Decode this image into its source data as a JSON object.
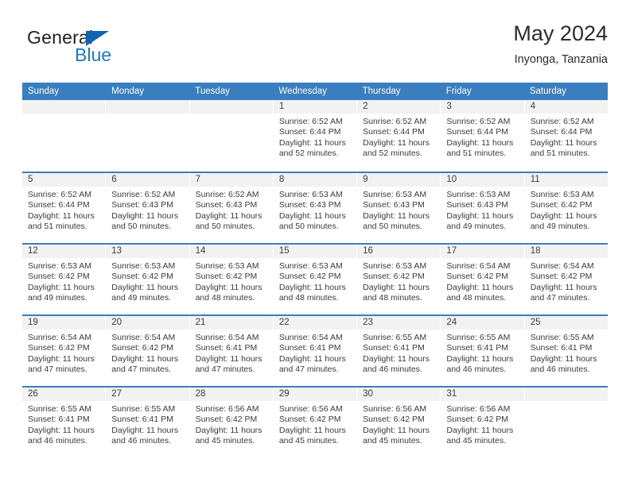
{
  "logo": {
    "word_top": "General",
    "word_bottom": "Blue",
    "triangle_color": "#1263ad",
    "blue_color": "#1f78c1"
  },
  "header": {
    "title": "May 2024",
    "subtitle": "Inyonga, Tanzania"
  },
  "theme": {
    "header_blue": "#3a7ebf",
    "day_strip_gray": "#f2f2f2",
    "text": "#3b3b3b"
  },
  "weekdays": [
    "Sunday",
    "Monday",
    "Tuesday",
    "Wednesday",
    "Thursday",
    "Friday",
    "Saturday"
  ],
  "weeks": [
    [
      {
        "day": "",
        "empty": true
      },
      {
        "day": "",
        "empty": true
      },
      {
        "day": "",
        "empty": true
      },
      {
        "day": "1",
        "sunrise": "Sunrise: 6:52 AM",
        "sunset": "Sunset: 6:44 PM",
        "daylight1": "Daylight: 11 hours",
        "daylight2": "and 52 minutes."
      },
      {
        "day": "2",
        "sunrise": "Sunrise: 6:52 AM",
        "sunset": "Sunset: 6:44 PM",
        "daylight1": "Daylight: 11 hours",
        "daylight2": "and 52 minutes."
      },
      {
        "day": "3",
        "sunrise": "Sunrise: 6:52 AM",
        "sunset": "Sunset: 6:44 PM",
        "daylight1": "Daylight: 11 hours",
        "daylight2": "and 51 minutes."
      },
      {
        "day": "4",
        "sunrise": "Sunrise: 6:52 AM",
        "sunset": "Sunset: 6:44 PM",
        "daylight1": "Daylight: 11 hours",
        "daylight2": "and 51 minutes."
      }
    ],
    [
      {
        "day": "5",
        "sunrise": "Sunrise: 6:52 AM",
        "sunset": "Sunset: 6:44 PM",
        "daylight1": "Daylight: 11 hours",
        "daylight2": "and 51 minutes."
      },
      {
        "day": "6",
        "sunrise": "Sunrise: 6:52 AM",
        "sunset": "Sunset: 6:43 PM",
        "daylight1": "Daylight: 11 hours",
        "daylight2": "and 50 minutes."
      },
      {
        "day": "7",
        "sunrise": "Sunrise: 6:52 AM",
        "sunset": "Sunset: 6:43 PM",
        "daylight1": "Daylight: 11 hours",
        "daylight2": "and 50 minutes."
      },
      {
        "day": "8",
        "sunrise": "Sunrise: 6:53 AM",
        "sunset": "Sunset: 6:43 PM",
        "daylight1": "Daylight: 11 hours",
        "daylight2": "and 50 minutes."
      },
      {
        "day": "9",
        "sunrise": "Sunrise: 6:53 AM",
        "sunset": "Sunset: 6:43 PM",
        "daylight1": "Daylight: 11 hours",
        "daylight2": "and 50 minutes."
      },
      {
        "day": "10",
        "sunrise": "Sunrise: 6:53 AM",
        "sunset": "Sunset: 6:43 PM",
        "daylight1": "Daylight: 11 hours",
        "daylight2": "and 49 minutes."
      },
      {
        "day": "11",
        "sunrise": "Sunrise: 6:53 AM",
        "sunset": "Sunset: 6:42 PM",
        "daylight1": "Daylight: 11 hours",
        "daylight2": "and 49 minutes."
      }
    ],
    [
      {
        "day": "12",
        "sunrise": "Sunrise: 6:53 AM",
        "sunset": "Sunset: 6:42 PM",
        "daylight1": "Daylight: 11 hours",
        "daylight2": "and 49 minutes."
      },
      {
        "day": "13",
        "sunrise": "Sunrise: 6:53 AM",
        "sunset": "Sunset: 6:42 PM",
        "daylight1": "Daylight: 11 hours",
        "daylight2": "and 49 minutes."
      },
      {
        "day": "14",
        "sunrise": "Sunrise: 6:53 AM",
        "sunset": "Sunset: 6:42 PM",
        "daylight1": "Daylight: 11 hours",
        "daylight2": "and 48 minutes."
      },
      {
        "day": "15",
        "sunrise": "Sunrise: 6:53 AM",
        "sunset": "Sunset: 6:42 PM",
        "daylight1": "Daylight: 11 hours",
        "daylight2": "and 48 minutes."
      },
      {
        "day": "16",
        "sunrise": "Sunrise: 6:53 AM",
        "sunset": "Sunset: 6:42 PM",
        "daylight1": "Daylight: 11 hours",
        "daylight2": "and 48 minutes."
      },
      {
        "day": "17",
        "sunrise": "Sunrise: 6:54 AM",
        "sunset": "Sunset: 6:42 PM",
        "daylight1": "Daylight: 11 hours",
        "daylight2": "and 48 minutes."
      },
      {
        "day": "18",
        "sunrise": "Sunrise: 6:54 AM",
        "sunset": "Sunset: 6:42 PM",
        "daylight1": "Daylight: 11 hours",
        "daylight2": "and 47 minutes."
      }
    ],
    [
      {
        "day": "19",
        "sunrise": "Sunrise: 6:54 AM",
        "sunset": "Sunset: 6:42 PM",
        "daylight1": "Daylight: 11 hours",
        "daylight2": "and 47 minutes."
      },
      {
        "day": "20",
        "sunrise": "Sunrise: 6:54 AM",
        "sunset": "Sunset: 6:42 PM",
        "daylight1": "Daylight: 11 hours",
        "daylight2": "and 47 minutes."
      },
      {
        "day": "21",
        "sunrise": "Sunrise: 6:54 AM",
        "sunset": "Sunset: 6:41 PM",
        "daylight1": "Daylight: 11 hours",
        "daylight2": "and 47 minutes."
      },
      {
        "day": "22",
        "sunrise": "Sunrise: 6:54 AM",
        "sunset": "Sunset: 6:41 PM",
        "daylight1": "Daylight: 11 hours",
        "daylight2": "and 47 minutes."
      },
      {
        "day": "23",
        "sunrise": "Sunrise: 6:55 AM",
        "sunset": "Sunset: 6:41 PM",
        "daylight1": "Daylight: 11 hours",
        "daylight2": "and 46 minutes."
      },
      {
        "day": "24",
        "sunrise": "Sunrise: 6:55 AM",
        "sunset": "Sunset: 6:41 PM",
        "daylight1": "Daylight: 11 hours",
        "daylight2": "and 46 minutes."
      },
      {
        "day": "25",
        "sunrise": "Sunrise: 6:55 AM",
        "sunset": "Sunset: 6:41 PM",
        "daylight1": "Daylight: 11 hours",
        "daylight2": "and 46 minutes."
      }
    ],
    [
      {
        "day": "26",
        "sunrise": "Sunrise: 6:55 AM",
        "sunset": "Sunset: 6:41 PM",
        "daylight1": "Daylight: 11 hours",
        "daylight2": "and 46 minutes."
      },
      {
        "day": "27",
        "sunrise": "Sunrise: 6:55 AM",
        "sunset": "Sunset: 6:41 PM",
        "daylight1": "Daylight: 11 hours",
        "daylight2": "and 46 minutes."
      },
      {
        "day": "28",
        "sunrise": "Sunrise: 6:56 AM",
        "sunset": "Sunset: 6:42 PM",
        "daylight1": "Daylight: 11 hours",
        "daylight2": "and 45 minutes."
      },
      {
        "day": "29",
        "sunrise": "Sunrise: 6:56 AM",
        "sunset": "Sunset: 6:42 PM",
        "daylight1": "Daylight: 11 hours",
        "daylight2": "and 45 minutes."
      },
      {
        "day": "30",
        "sunrise": "Sunrise: 6:56 AM",
        "sunset": "Sunset: 6:42 PM",
        "daylight1": "Daylight: 11 hours",
        "daylight2": "and 45 minutes."
      },
      {
        "day": "31",
        "sunrise": "Sunrise: 6:56 AM",
        "sunset": "Sunset: 6:42 PM",
        "daylight1": "Daylight: 11 hours",
        "daylight2": "and 45 minutes."
      },
      {
        "day": "",
        "empty": true
      }
    ]
  ]
}
